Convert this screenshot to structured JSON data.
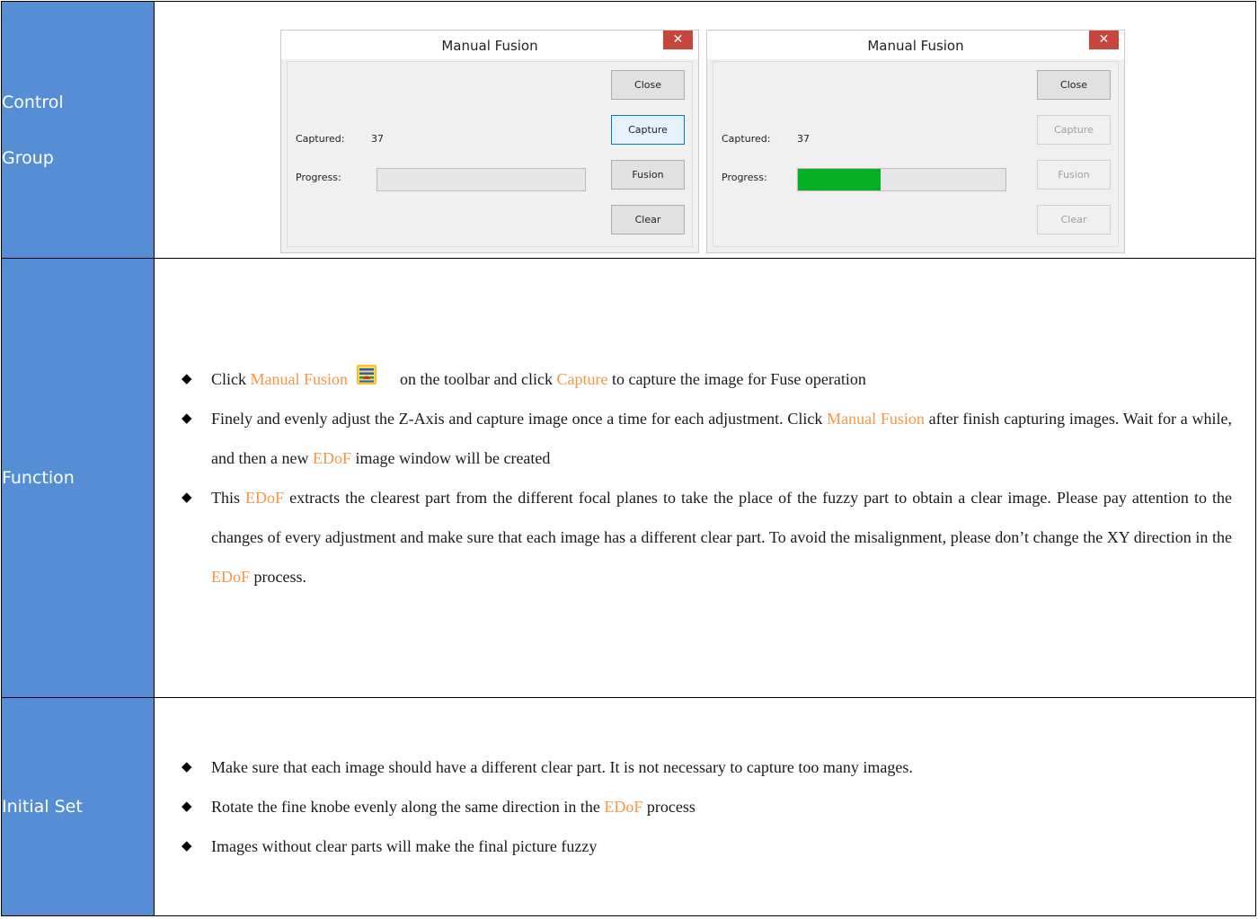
{
  "rows": {
    "control_group": {
      "label_line1": "Control",
      "label_line2": "Group"
    },
    "function": {
      "label": "Function"
    },
    "initial_set": {
      "label": "Initial Set"
    }
  },
  "dialogs": [
    {
      "title": "Manual Fusion",
      "close_x": "✕",
      "captured_label": "Captured:",
      "captured_value": "37",
      "progress_label": "Progress:",
      "progress_fraction": 0.0,
      "buttons": {
        "close": "Close",
        "capture": "Capture",
        "fusion": "Fusion",
        "clear": "Clear"
      },
      "state": "capture-focused"
    },
    {
      "title": "Manual Fusion",
      "close_x": "✕",
      "captured_label": "Captured:",
      "captured_value": "37",
      "progress_label": "Progress:",
      "progress_fraction": 0.4,
      "buttons": {
        "close": "Close",
        "capture": "Capture",
        "fusion": "Fusion",
        "clear": "Clear"
      },
      "state": "processing-disabled"
    }
  ],
  "function_items": {
    "i1": {
      "a": "Click ",
      "b": "Manual Fusion",
      "c": "on the toolbar and click ",
      "d": "Capture",
      "e": " to capture the image for Fuse operation",
      "icon": "manual-fusion-toolbar-icon"
    },
    "i2": {
      "a": "Finely and evenly adjust the Z-Axis and capture image once a time for each adjustment. Click ",
      "b": "Manual Fusion",
      "c": " after finish capturing images. Wait for a while, and then a new ",
      "d": "EDoF",
      "e": " image window will be created"
    },
    "i3": {
      "a": "This ",
      "b": "EDoF",
      "c": " extracts the clearest part from the different focal planes to take the place of the fuzzy part to obtain a clear image. Please pay attention to the changes of every adjustment and make sure that each image has a different clear part. To avoid the misalignment, please don’t change the XY direction in the ",
      "d": "EDoF",
      "e": " process."
    }
  },
  "initial_items": {
    "i1": {
      "a": "Make sure that each image should have a different clear part. It is not necessary to capture too many images."
    },
    "i2": {
      "a": "Rotate the fine knobe evenly along the same direction in the ",
      "b": "EDoF",
      "c": " process"
    },
    "i3": {
      "a": "Images without clear parts will make the final picture fuzzy"
    }
  },
  "bullet_glyph": "◆",
  "colors": {
    "label_bg": "#558ed5",
    "highlight": "#f79646",
    "progress_green": "#06b025",
    "close_red": "#c7463c"
  }
}
